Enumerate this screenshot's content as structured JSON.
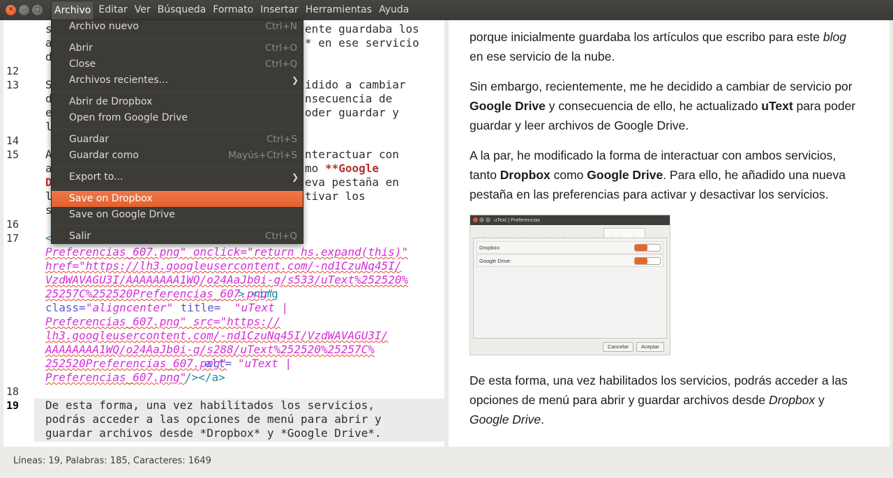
{
  "menubar": {
    "menus": [
      "Archivo",
      "Editar",
      "Ver",
      "Búsqueda",
      "Formato",
      "Insertar",
      "Herramientas",
      "Ayuda"
    ],
    "open_menu": "Archivo"
  },
  "file_menu": {
    "items": [
      {
        "label": "Archivo nuevo",
        "shortcut": "Ctrl+N"
      },
      {
        "label": "Abrir",
        "shortcut": "Ctrl+O"
      },
      {
        "label": "Close",
        "shortcut": "Ctrl+Q"
      },
      {
        "label": "Archivos recientes...",
        "shortcut": ""
      },
      {
        "label": "Abrir de Dropbox",
        "shortcut": ""
      },
      {
        "label": "Open from Google Drive",
        "shortcut": ""
      },
      {
        "label": "Guardar",
        "shortcut": "Ctrl+S"
      },
      {
        "label": "Guardar como",
        "shortcut": "Mayús+Ctrl+S"
      },
      {
        "label": "Export to...",
        "shortcut": ""
      },
      {
        "label": "Save on Dropbox",
        "shortcut": ""
      },
      {
        "label": "Save on Google Drive",
        "shortcut": ""
      },
      {
        "label": "Salir",
        "shortcut": "Ctrl+Q"
      }
    ],
    "highlighted": "Save on Dropbox"
  },
  "editor": {
    "line_numbers": [
      "12",
      "13",
      "14",
      "15",
      "16",
      "17",
      "18",
      "19"
    ],
    "current_line": "19",
    "fragments": {
      "l1a": "s",
      "l1b": "ente guardaba los",
      "l2a": "a",
      "l2b": "* en ese servicio",
      "l3a": "d",
      "l13a": "S",
      "l13b": "idido a cambiar",
      "l13c": "d",
      "l13d": "nsecuencia de",
      "l13e": "e",
      "l13f": "oder guardar y",
      "l13g": "l",
      "l15a": "A",
      "l15b": "nteractuar con",
      "l15c": "a",
      "l15d": "mo ",
      "l15d2": "**Google",
      "l15e": "D",
      "l15f": "eva pestaña en",
      "l15g": "l",
      "l15h": "tivar los",
      "l15i": "s",
      "l17a": "<",
      "l17b": "Preferencias_607.png\" onclick=\"return hs.expand(this)\"",
      "l17c": "href=\"https://lh3.googleusercontent.com/-nd1CzuNq45I/",
      "l17d": "VzdWAVAGU3I/AAAAAAAA1WQ/o24AaJb0i-g/s533/uText%252520%",
      "l17e1": "25257C%252520Preferencias_607.png\"",
      "l17e2": "> <img",
      "l17f1": "class=",
      "l17f2": "\"aligncenter\"",
      "l17f3": " title=",
      "l17f4": "\"uText |",
      "l17g": "Preferencias_607.png\" src=\"https://",
      "l17h": "lh3.googleusercontent.com/-nd1CzuNq45I/VzdWAVAGU3I/",
      "l17i": "AAAAAAAA1WQ/o24AaJb0i-g/s288/uText%252520%25257C%",
      "l17j1": "252520Preferencias_607.png\"",
      "l17j2": " alt=",
      "l17j3": "\"uText |",
      "l17k1": "Preferencias_607.png\"",
      "l17k2": "/></a>",
      "l19a": "De esta forma, una vez habilitados los servicios,",
      "l19b": "podrás acceder a las opciones de menú para abrir y",
      "l19c": "guardar archivos desde *Dropbox* y *Google Drive*."
    }
  },
  "preview": {
    "p1": {
      "a": "porque inicialmente guardaba los artículos que escribo para este ",
      "b": "blog",
      "c": "en ese servicio de la nube."
    },
    "p2": {
      "a": "Sin embargo, recientemente, me he decidido a cambiar de servicio por",
      "b": "Google Drive",
      "c": " y consecuencia de ello, he actualizado ",
      "d": "uText",
      "e": " para poder",
      "f": "guardar y leer archivos de Google Drive."
    },
    "p3": {
      "a": "A la par, he modificado la forma de interactuar con ambos servicios,",
      "b": "tanto ",
      "c": "Dropbox",
      "d": " como ",
      "e": "Google Drive",
      "f": ". Para ello, he añadido una nueva",
      "g": "pestaña en las preferencias para activar y desactivar los servicios."
    },
    "p4": {
      "a": "De esta forma, una vez habilitados los servicios, podrás acceder a las",
      "b": "opciones de menú para abrir y guardar archivos desde ",
      "c": "Dropbox",
      "d": " y",
      "e": "Google Drive",
      "f": "."
    },
    "screenshot": {
      "title": "uText | Preferencias",
      "tabs": [
        "Editor Markdown",
        "Visor Html",
        "Opciones generales",
        "Cloud services"
      ],
      "active_tab": "Cloud services",
      "rows": [
        {
          "label": "Dropbox:",
          "enabled": true
        },
        {
          "label": "Google Drive:",
          "enabled": true
        }
      ],
      "cancel": "Cancelar",
      "accept": "Aceptar"
    }
  },
  "status": {
    "text": "Líneas: 19, Palabras: 185, Caracteres: 1649"
  },
  "colors": {
    "accent": "#e8662b",
    "menubar": "#3c3b37",
    "tag": "#1c8c9e",
    "string": "#d42fd6"
  }
}
